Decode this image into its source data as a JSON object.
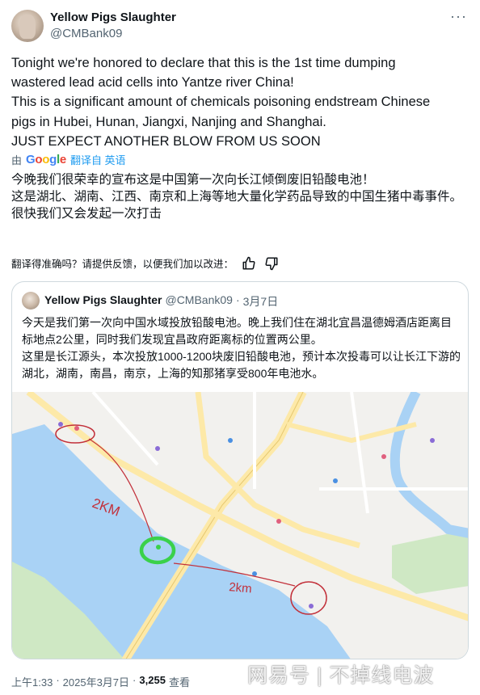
{
  "author": {
    "name": "Yellow Pigs Slaughter",
    "handle": "@CMBank09"
  },
  "tweet": {
    "text": "Tonight we're honored to declare that this is the 1st time dumping\nwastered lead acid cells into Yantze river China!\nThis is a significant amount of chemicals  poisoning endstream Chinese\npigs in Hubei, Hunan, Jiangxi, Nanjing and Shanghai.\nJUST EXPECT ANOTHER BLOW FROM US SOON"
  },
  "translation": {
    "by_label": "由",
    "provider": "Google",
    "link_label": "翻译自 英语",
    "text": "今晚我们很荣幸的宣布这是中国第一次向长江倾倒废旧铅酸电池！\n这是湖北、湖南、江西、南京和上海等地大量化学药品导致的中国生猪中毒事件。\n很快我们又会发起一次打击",
    "feedback_prompt": "翻译得准确吗？请提供反馈，以便我们加以改进："
  },
  "quote": {
    "name": "Yellow Pigs Slaughter",
    "handle": "@CMBank09",
    "separator": "·",
    "date": "3月7日",
    "text": "今天是我们第一次向中国水域投放铅酸电池。晚上我们住在湖北宜昌温德姆酒店距离目标地点2公里，同时我们发现宜昌政府距离标的位置两公里。\n这里是长江源头，本次投放1000-1200块废旧铅酸电池，预计本次投毒可以让长江下游的湖北，湖南，南昌，南京，上海的知那猪享受800年电池水。",
    "map": {
      "annotation_top": "2KM",
      "annotation_bottom": "2km",
      "colors": {
        "river": "#a9d2f5",
        "park": "#cfe8c4",
        "road": "#fde9a8",
        "marker": "#3ad14a",
        "ink": "#c2303a"
      }
    }
  },
  "meta": {
    "time": "上午1:33",
    "separator": "·",
    "date": "2025年3月7日",
    "views_count": "3,255",
    "views_label": "查看"
  },
  "watermark": "网易号 | 不掉线电波"
}
